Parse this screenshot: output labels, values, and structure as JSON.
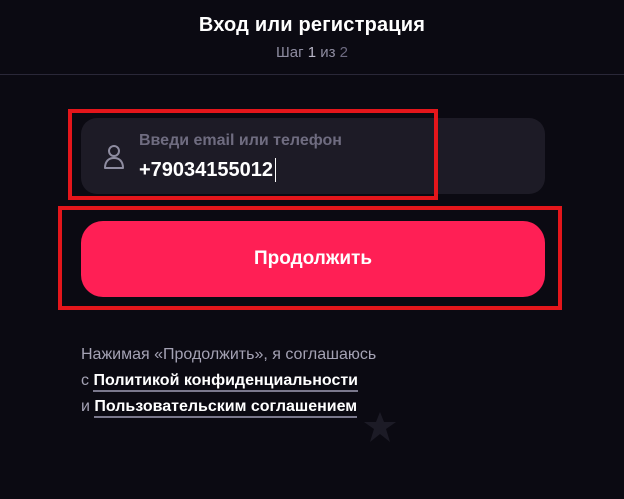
{
  "header": {
    "title": "Вход или регистрация",
    "step_prefix": "Шаг",
    "step_current": "1",
    "step_of": "из",
    "step_total": "2"
  },
  "login_field": {
    "label": "Введи email или телефон",
    "value": "+79034155012",
    "icon": "user-icon"
  },
  "continue_button": {
    "label": "Продолжить"
  },
  "legal": {
    "line1": "Нажимая «Продолжить», я соглашаюсь",
    "line2_prefix": "с",
    "privacy_link": "Политикой конфиденциальности",
    "line3_prefix": "и",
    "terms_link": "Пользовательским соглашением"
  },
  "colors": {
    "background": "#0b0a12",
    "field": "#1d1b26",
    "accent": "#ff1f55",
    "highlight_box": "#e4161b"
  }
}
